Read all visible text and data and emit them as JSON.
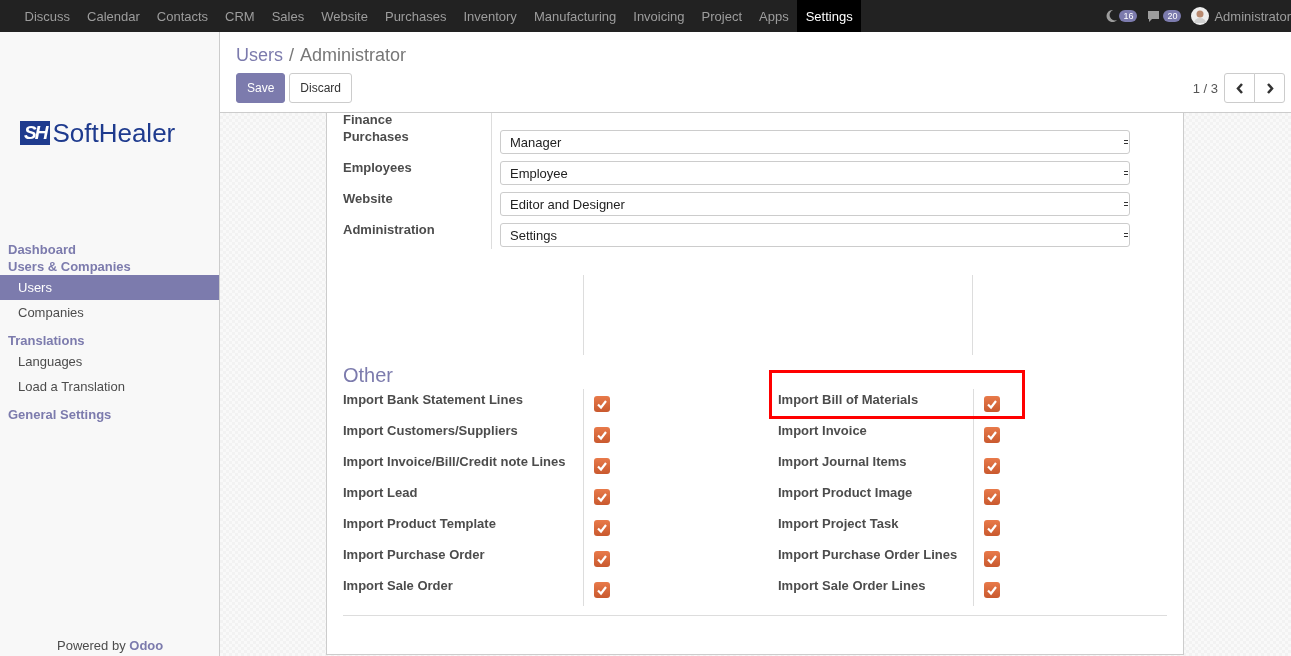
{
  "navbar": {
    "apps": [
      {
        "label": "Discuss",
        "selected": false
      },
      {
        "label": "Calendar",
        "selected": false
      },
      {
        "label": "Contacts",
        "selected": false
      },
      {
        "label": "CRM",
        "selected": false
      },
      {
        "label": "Sales",
        "selected": false
      },
      {
        "label": "Website",
        "selected": false
      },
      {
        "label": "Purchases",
        "selected": false
      },
      {
        "label": "Inventory",
        "selected": false
      },
      {
        "label": "Manufacturing",
        "selected": false
      },
      {
        "label": "Invoicing",
        "selected": false
      },
      {
        "label": "Project",
        "selected": false
      },
      {
        "label": "Apps",
        "selected": false
      },
      {
        "label": "Settings",
        "selected": true
      }
    ],
    "activity_count": "16",
    "message_count": "20",
    "user": "Administrator"
  },
  "sidebar": {
    "logo": {
      "mark": "SH",
      "text": "SoftHealer"
    },
    "items": [
      {
        "kind": "header",
        "label": "Dashboard",
        "selected": false
      },
      {
        "kind": "header",
        "label": "Users & Companies",
        "selected": false
      },
      {
        "kind": "item",
        "label": "Users",
        "selected": true
      },
      {
        "kind": "item",
        "label": "Companies",
        "selected": false
      },
      {
        "kind": "header",
        "label": "Translations",
        "selected": false
      },
      {
        "kind": "item",
        "label": "Languages",
        "selected": false
      },
      {
        "kind": "item",
        "label": "Load a Translation",
        "selected": false
      },
      {
        "kind": "header",
        "label": "General Settings",
        "selected": false
      }
    ],
    "powered_by": {
      "text": "Powered by",
      "link": "Odoo"
    }
  },
  "control_panel": {
    "breadcrumb": [
      {
        "label": "Users"
      },
      {
        "label": "Administrator"
      }
    ],
    "separator": "/",
    "buttons": [
      {
        "label": "Save",
        "kind": "primary"
      },
      {
        "label": "Discard",
        "kind": "secondary"
      }
    ],
    "pager": "1 / 3"
  },
  "access_rights": {
    "cut_label": "Finance",
    "rows": [
      {
        "label": "Purchases",
        "value": "Manager"
      },
      {
        "label": "Employees",
        "value": "Employee"
      },
      {
        "label": "Website",
        "value": "Editor and Designer"
      },
      {
        "label": "Administration",
        "value": "Settings"
      }
    ]
  },
  "other": {
    "title": "Other",
    "rows": [
      {
        "left": {
          "label": "Import Bank Statement Lines",
          "checked": true,
          "highlighted": false
        },
        "right": {
          "label": "Import Bill of Materials",
          "checked": true,
          "highlighted": true
        }
      },
      {
        "left": {
          "label": "Import Customers/Suppliers",
          "checked": true,
          "highlighted": false
        },
        "right": {
          "label": "Import Invoice",
          "checked": true,
          "highlighted": false
        }
      },
      {
        "left": {
          "label": "Import Invoice/Bill/Credit note Lines",
          "checked": true,
          "highlighted": false
        },
        "right": {
          "label": "Import Journal Items",
          "checked": true,
          "highlighted": false
        }
      },
      {
        "left": {
          "label": "Import Lead",
          "checked": true,
          "highlighted": false
        },
        "right": {
          "label": "Import Product Image",
          "checked": true,
          "highlighted": false
        }
      },
      {
        "left": {
          "label": "Import Product Template",
          "checked": true,
          "highlighted": false
        },
        "right": {
          "label": "Import Project Task",
          "checked": true,
          "highlighted": false
        }
      },
      {
        "left": {
          "label": "Import Purchase Order",
          "checked": true,
          "highlighted": false
        },
        "right": {
          "label": "Import Purchase Order Lines",
          "checked": true,
          "highlighted": false
        }
      },
      {
        "left": {
          "label": "Import Sale Order",
          "checked": true,
          "highlighted": false
        },
        "right": {
          "label": "Import Sale Order Lines",
          "checked": true,
          "highlighted": false
        }
      }
    ]
  }
}
